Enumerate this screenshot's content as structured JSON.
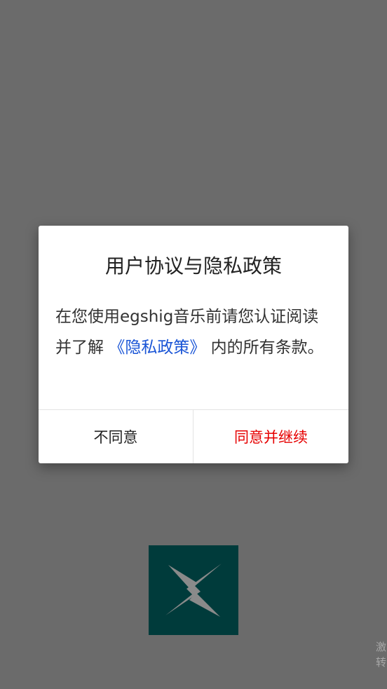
{
  "dialog": {
    "title": "用户协议与隐私政策",
    "body_prefix": "在您使用egshig音乐前请您认证阅读并了解 ",
    "policy_link": "《隐私政策》",
    "body_suffix": " 内的所有条款。",
    "decline_label": "不同意",
    "accept_label": "同意并继续"
  },
  "splash": {
    "logo_icon": "lightning-cross-logo-icon",
    "skip_label_line1": "激",
    "skip_label_line2": "转"
  },
  "colors": {
    "overlay": "#6b6b6b",
    "accept": "#e60000",
    "link": "#1a55d6",
    "logo_bg": "#003b3b"
  }
}
